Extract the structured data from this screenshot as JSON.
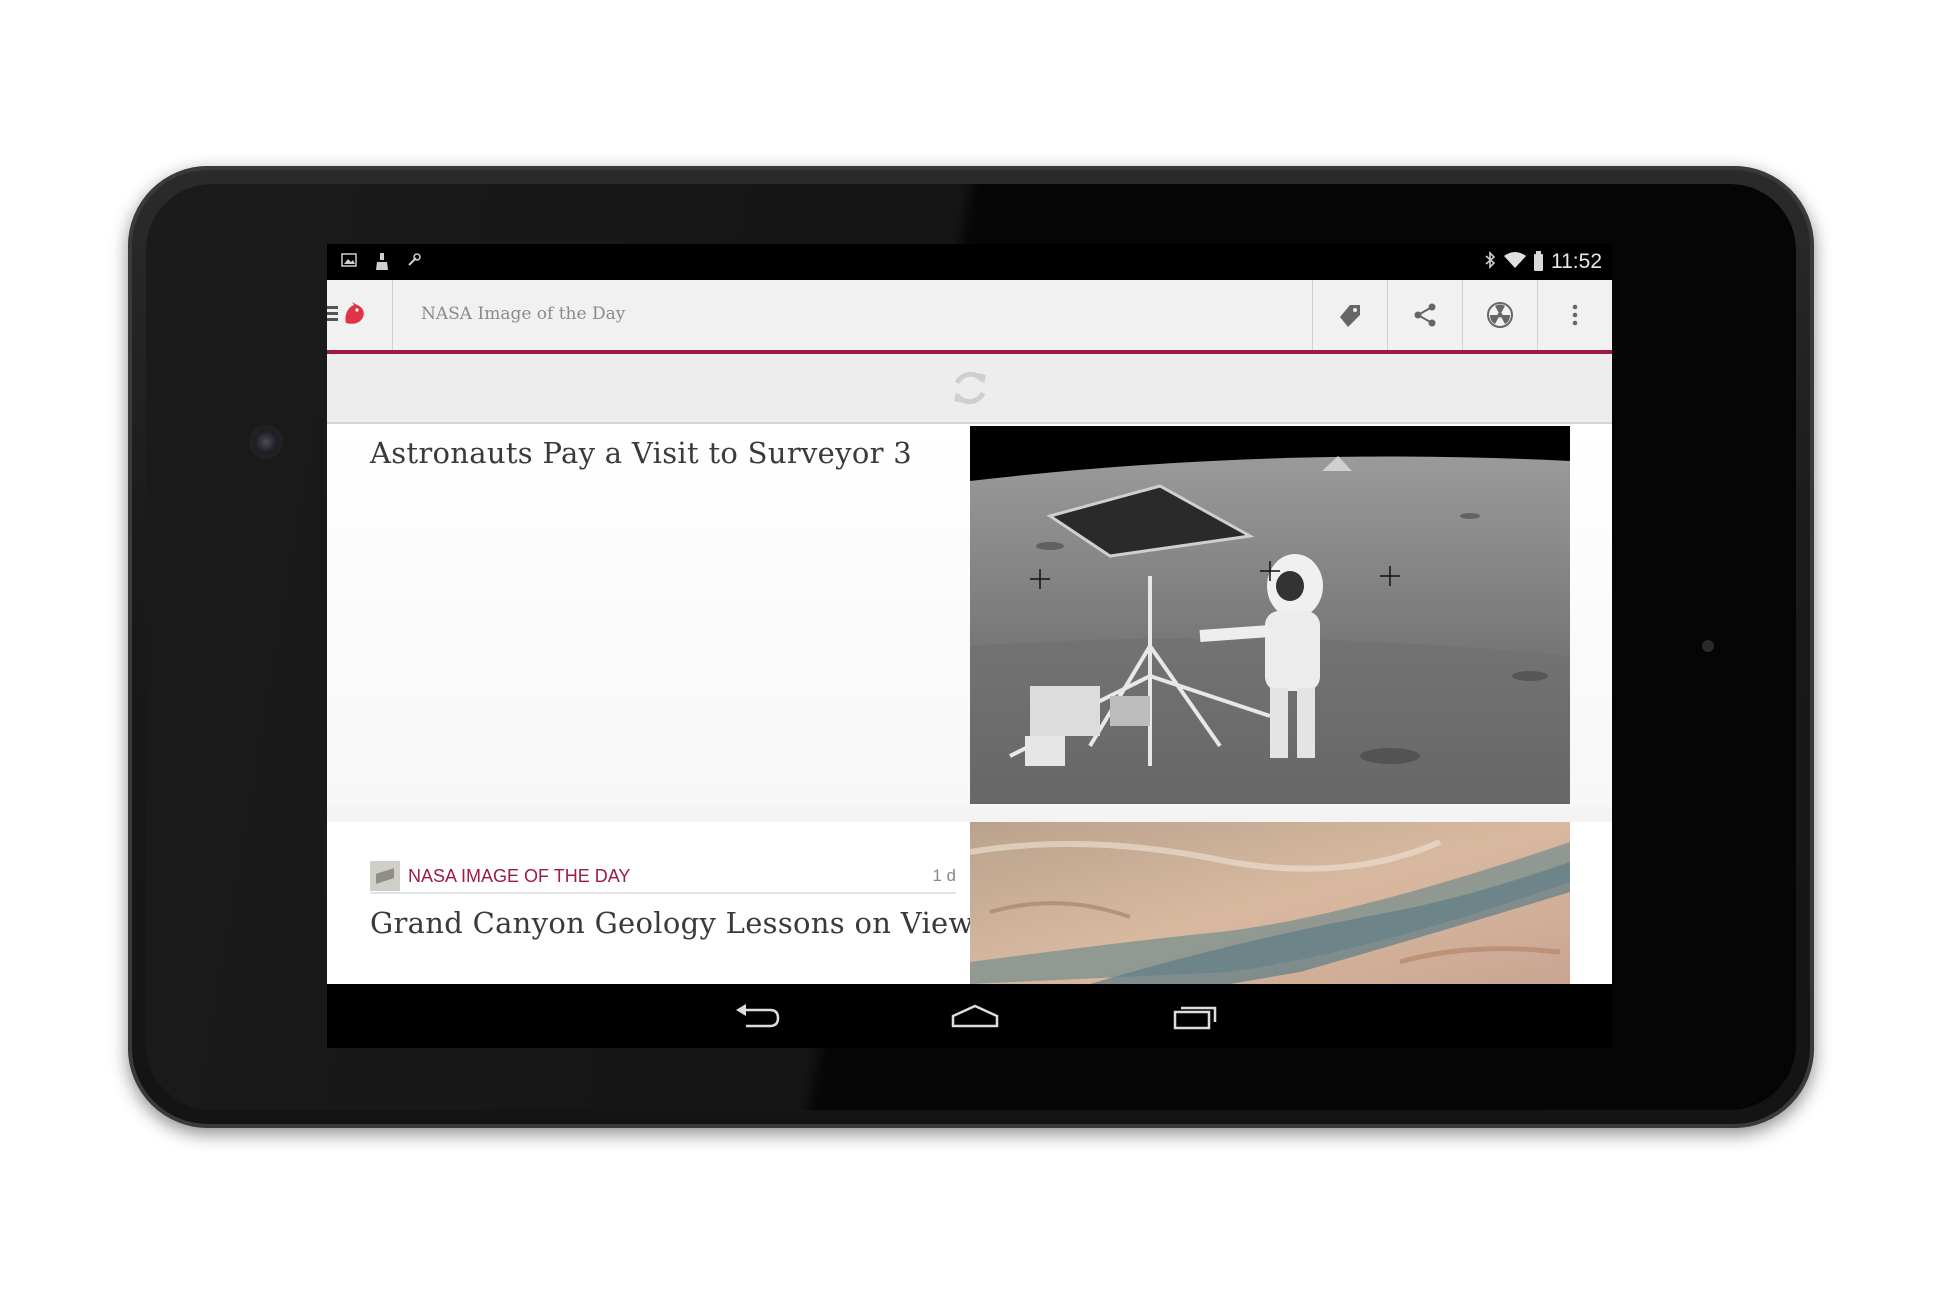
{
  "status_bar": {
    "left_icons": [
      "image-notification-icon",
      "cleaner-notification-icon",
      "tool-notification-icon"
    ],
    "right_icons": [
      "bluetooth-icon",
      "wifi-icon",
      "battery-icon"
    ],
    "time": "11:52"
  },
  "app_bar": {
    "title": "NASA Image of the Day",
    "accent_color": "#9e1b45",
    "actions": [
      "tag-icon",
      "share-icon",
      "radiation-icon",
      "overflow-menu-icon"
    ]
  },
  "feed": {
    "articles": [
      {
        "title": "Astronauts Pay a Visit to Surveyor 3"
      },
      {
        "source": "NASA IMAGE OF THE DAY",
        "age": "1 d",
        "title": "Grand Canyon Geology Lessons on View"
      }
    ]
  },
  "system_nav": [
    "back-icon",
    "home-icon",
    "recents-icon"
  ]
}
